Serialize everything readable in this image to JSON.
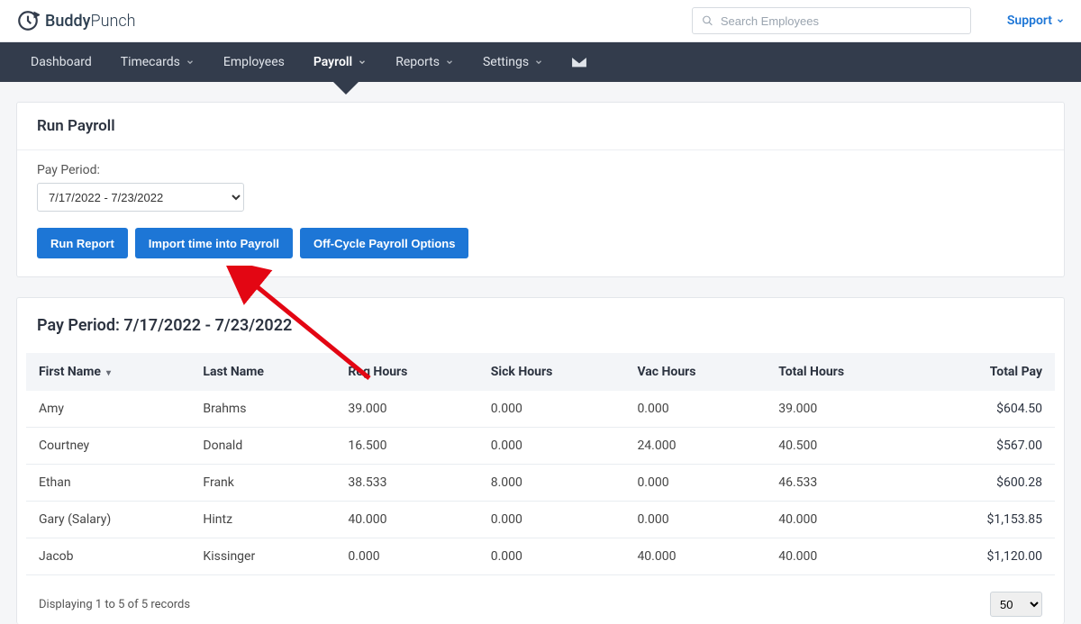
{
  "brand": {
    "name": "Buddy",
    "suffix": "Punch"
  },
  "search": {
    "placeholder": "Search Employees"
  },
  "support": {
    "label": "Support"
  },
  "nav": {
    "items": [
      {
        "label": "Dashboard",
        "dropdown": false
      },
      {
        "label": "Timecards",
        "dropdown": true
      },
      {
        "label": "Employees",
        "dropdown": false
      },
      {
        "label": "Payroll",
        "dropdown": true,
        "active": true
      },
      {
        "label": "Reports",
        "dropdown": true
      },
      {
        "label": "Settings",
        "dropdown": true
      }
    ]
  },
  "page": {
    "title": "Run Payroll",
    "period_label": "Pay Period:",
    "period_value": "7/17/2022 - 7/23/2022",
    "buttons": {
      "run_report": "Run Report",
      "import": "Import time into Payroll",
      "off_cycle": "Off-Cycle Payroll Options"
    }
  },
  "report": {
    "title": "Pay Period: 7/17/2022 - 7/23/2022",
    "columns": {
      "first_name": "First Name",
      "last_name": "Last Name",
      "reg_hours": "Reg Hours",
      "sick_hours": "Sick Hours",
      "vac_hours": "Vac Hours",
      "total_hours": "Total Hours",
      "total_pay": "Total Pay"
    },
    "rows": [
      {
        "first": "Amy",
        "last": "Brahms",
        "reg": "39.000",
        "sick": "0.000",
        "vac": "0.000",
        "total": "39.000",
        "pay": "$604.50"
      },
      {
        "first": "Courtney",
        "last": "Donald",
        "reg": "16.500",
        "sick": "0.000",
        "vac": "24.000",
        "total": "40.500",
        "pay": "$567.00"
      },
      {
        "first": "Ethan",
        "last": "Frank",
        "reg": "38.533",
        "sick": "8.000",
        "vac": "0.000",
        "total": "46.533",
        "pay": "$600.28"
      },
      {
        "first": "Gary (Salary)",
        "last": "Hintz",
        "reg": "40.000",
        "sick": "0.000",
        "vac": "0.000",
        "total": "40.000",
        "pay": "$1,153.85"
      },
      {
        "first": "Jacob",
        "last": "Kissinger",
        "reg": "0.000",
        "sick": "0.000",
        "vac": "40.000",
        "total": "40.000",
        "pay": "$1,120.00"
      }
    ],
    "footer": {
      "displaying": "Displaying 1 to 5 of 5 records",
      "page_size": "50"
    }
  }
}
